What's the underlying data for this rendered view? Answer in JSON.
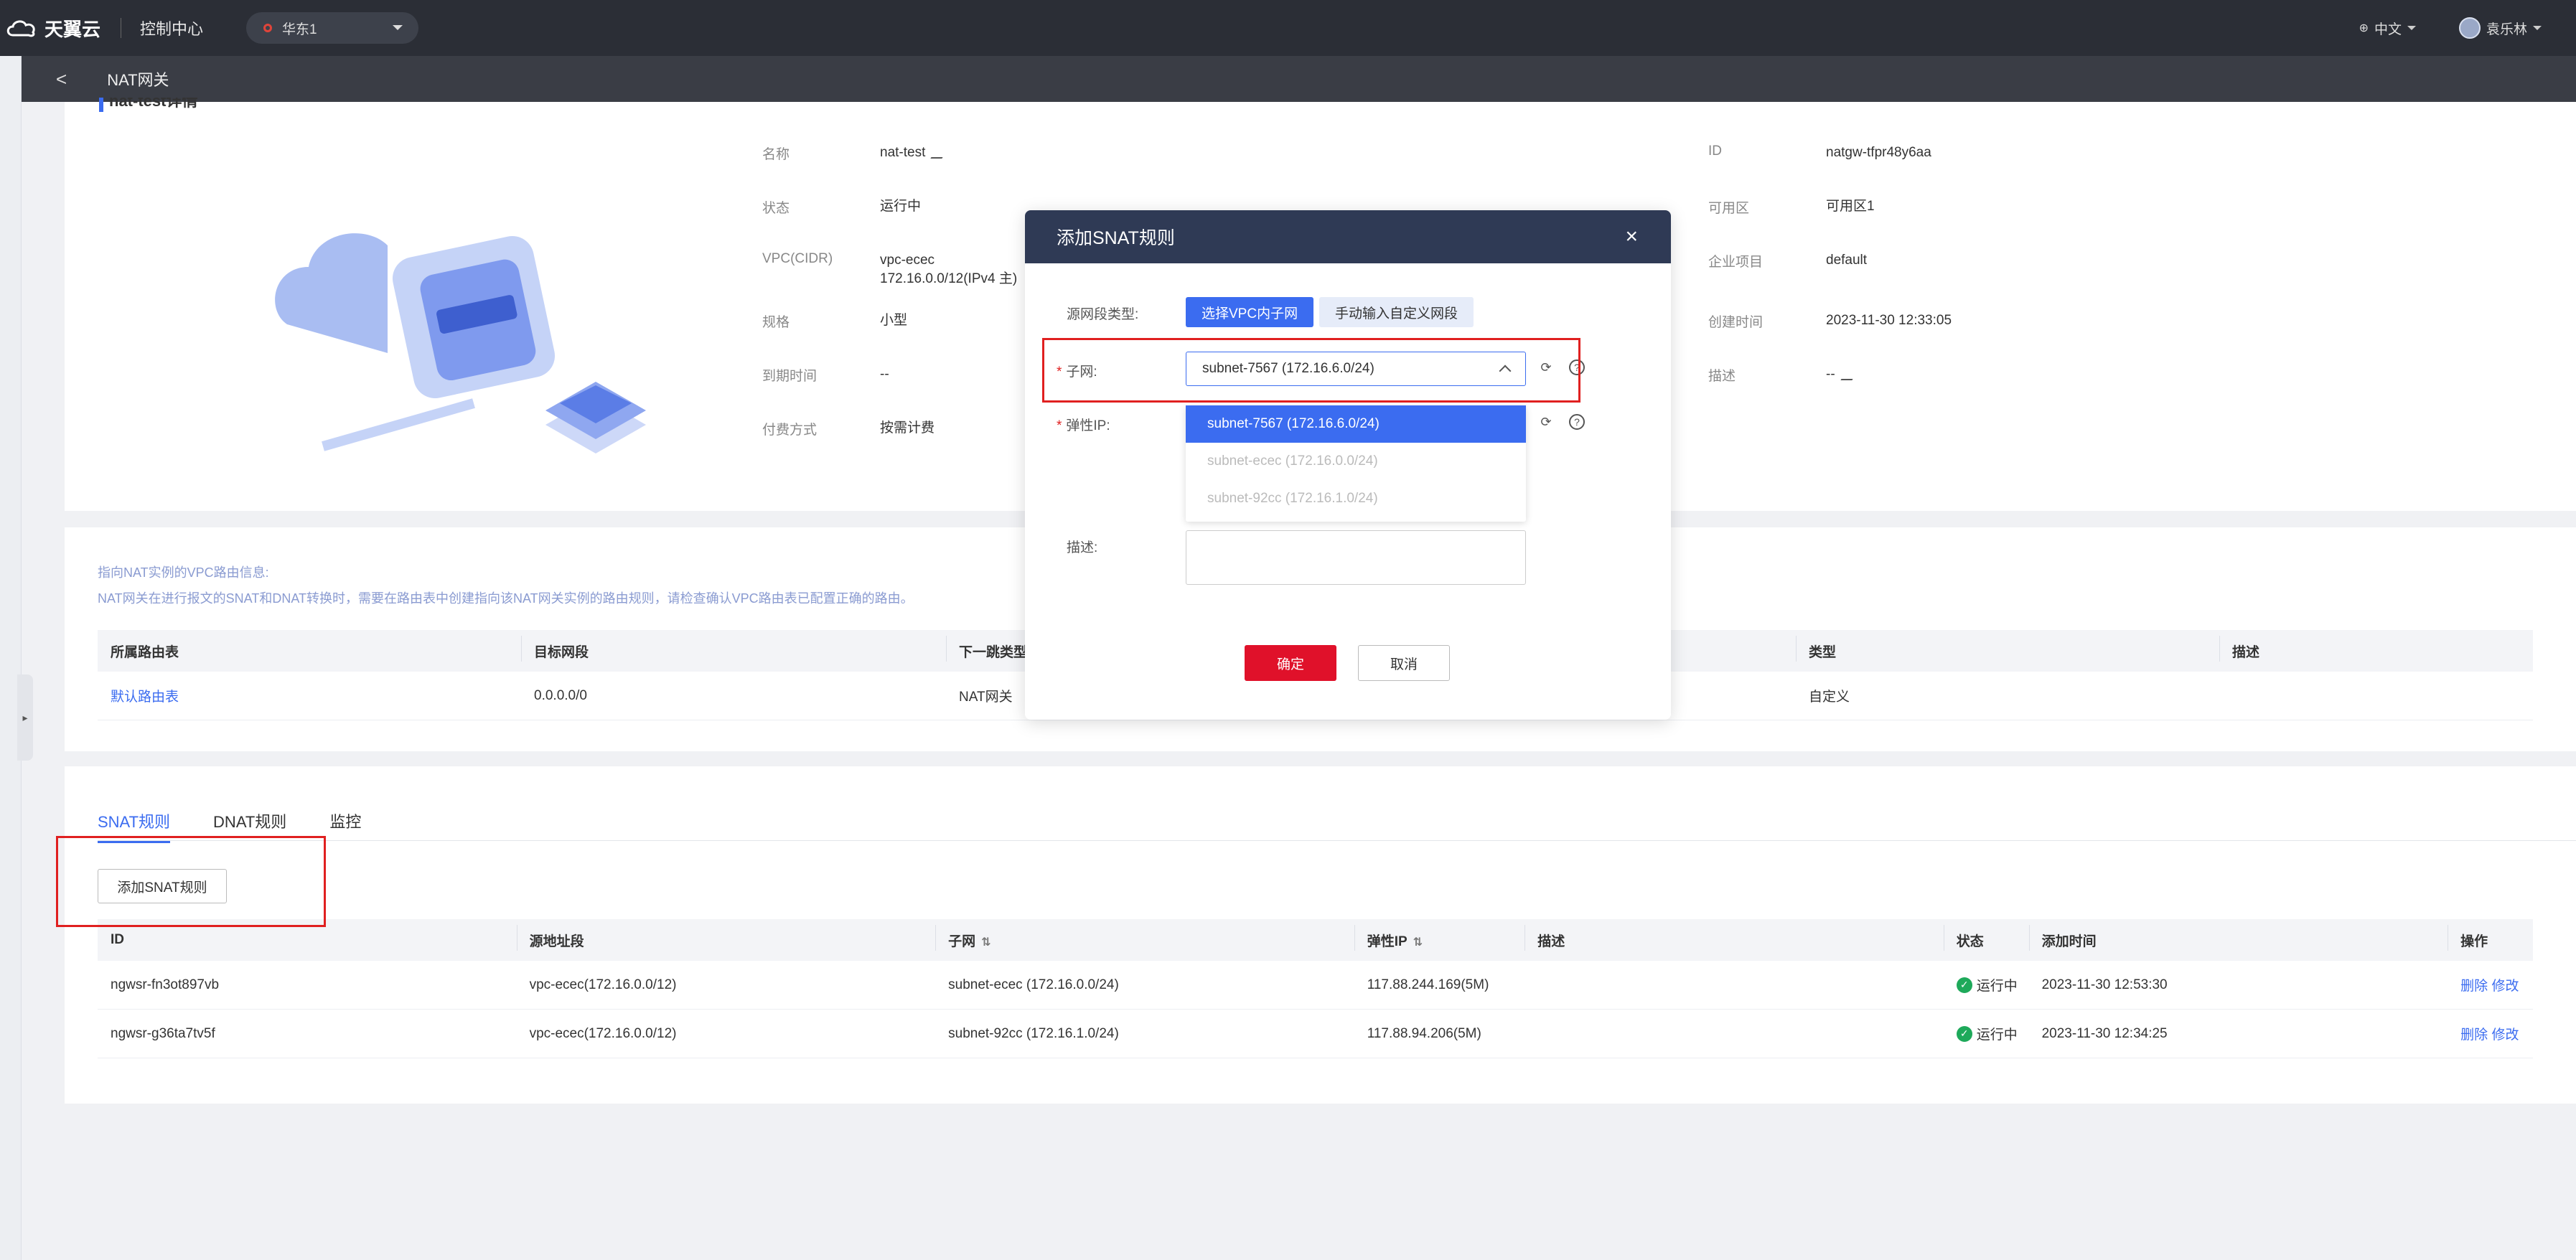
{
  "topbar": {
    "brand": "天翼云",
    "console": "控制中心",
    "region": "华东1",
    "language": "中文",
    "username": "袁乐林"
  },
  "subbar": {
    "back": "<",
    "title": "NAT网关"
  },
  "detail": {
    "section_title": "nat-test详情",
    "left": [
      {
        "label": "名称",
        "value": "nat-test"
      },
      {
        "label": "状态",
        "value": "运行中"
      },
      {
        "label": "VPC(CIDR)",
        "value": "vpc-ecec",
        "value2": "172.16.0.0/12(IPv4 主)"
      },
      {
        "label": "规格",
        "value": "小型"
      },
      {
        "label": "到期时间",
        "value": "--"
      },
      {
        "label": "付费方式",
        "value": "按需计费"
      }
    ],
    "right": [
      {
        "label": "ID",
        "value": "natgw-tfpr48y6aa"
      },
      {
        "label": "可用区",
        "value": "可用区1"
      },
      {
        "label": "企业项目",
        "value": "default"
      },
      {
        "label": "创建时间",
        "value": "2023-11-30 12:33:05"
      },
      {
        "label": "描述",
        "value": "--"
      }
    ]
  },
  "route": {
    "hint1": "指向NAT实例的VPC路由信息:",
    "hint2": "NAT网关在进行报文的SNAT和DNAT转换时，需要在路由表中创建指向该NAT网关实例的路由规则，请检查确认VPC路由表已配置正确的路由。",
    "headers": [
      "所属路由表",
      "目标网段",
      "下一跳类型",
      "类型",
      "描述"
    ],
    "rows": [
      [
        "默认路由表",
        "0.0.0.0/0",
        "NAT网关",
        "自定义",
        ""
      ]
    ]
  },
  "rules": {
    "tabs": [
      "SNAT规则",
      "DNAT规则",
      "监控"
    ],
    "add_button": "添加SNAT规则",
    "headers": [
      "ID",
      "源地址段",
      "子网",
      "弹性IP",
      "描述",
      "状态",
      "添加时间",
      "操作"
    ],
    "rows": [
      {
        "id": "ngwsr-fn3ot897vb",
        "src": "vpc-ecec(172.16.0.0/12)",
        "subnet": "subnet-ecec (172.16.0.0/24)",
        "eip": "117.88.244.169(5M)",
        "desc": "",
        "status": "运行中",
        "time": "2023-11-30 12:53:30",
        "op_delete": "删除",
        "op_edit": "修改"
      },
      {
        "id": "ngwsr-g36ta7tv5f",
        "src": "vpc-ecec(172.16.0.0/12)",
        "subnet": "subnet-92cc (172.16.1.0/24)",
        "eip": "117.88.94.206(5M)",
        "desc": "",
        "status": "运行中",
        "time": "2023-11-30 12:34:25",
        "op_delete": "删除",
        "op_edit": "修改"
      }
    ]
  },
  "modal": {
    "title": "添加SNAT规则",
    "close": "×",
    "source_type_label": "源网段类型:",
    "source_type_options": [
      "选择VPC内子网",
      "手动输入自定义网段"
    ],
    "subnet_label": "子网:",
    "subnet_value": "subnet-7567 (172.16.6.0/24)",
    "eip_label": "弹性IP:",
    "desc_label": "描述:",
    "subnet_options": [
      "subnet-7567 (172.16.6.0/24)",
      "subnet-ecec (172.16.0.0/24)",
      "subnet-92cc (172.16.1.0/24)"
    ],
    "confirm": "确定",
    "cancel": "取消"
  },
  "colors": {
    "accent": "#3b6cf0",
    "danger": "#e0112a",
    "header_bg": "#2b2e36",
    "modal_head": "#2f3a55",
    "status_ok": "#1ea95a"
  }
}
